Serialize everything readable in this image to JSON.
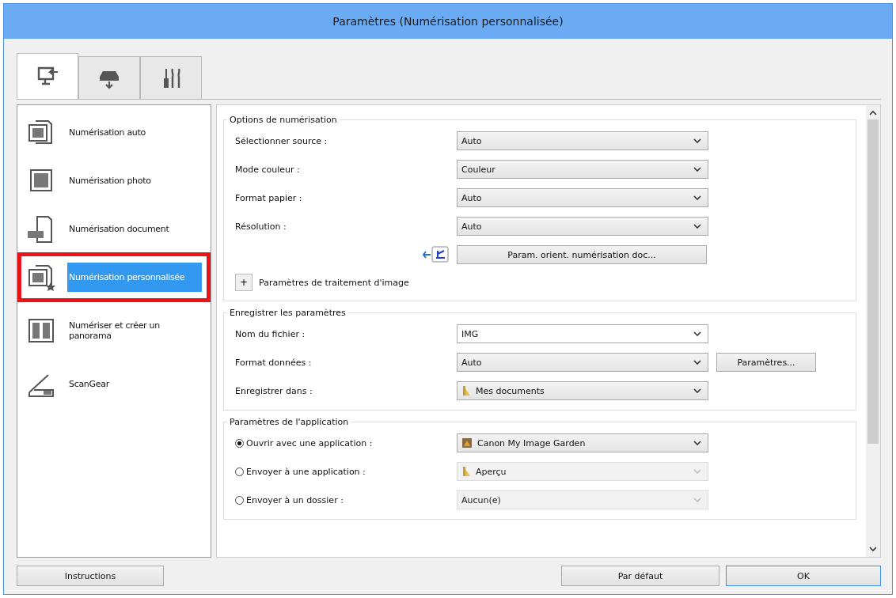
{
  "window": {
    "title": "Paramètres (Numérisation personnalisée)"
  },
  "tabs": [
    {
      "kind": "computer",
      "selected": true
    },
    {
      "kind": "scanner",
      "selected": false
    },
    {
      "kind": "tools",
      "selected": false
    }
  ],
  "sidebar": {
    "items": [
      {
        "label": "Numérisation auto",
        "kind": "auto",
        "selected": false,
        "highlighted": false
      },
      {
        "label": "Numérisation photo",
        "kind": "photo",
        "selected": false,
        "highlighted": false
      },
      {
        "label": "Numérisation document",
        "kind": "document",
        "selected": false,
        "highlighted": false
      },
      {
        "label": "Numérisation personnalisée",
        "kind": "custom",
        "selected": true,
        "highlighted": true
      },
      {
        "label": "Numériser et créer un panorama",
        "kind": "panorama",
        "selected": false,
        "highlighted": false
      },
      {
        "label": "ScanGear",
        "kind": "scangear",
        "selected": false,
        "highlighted": false
      }
    ]
  },
  "sections": [
    {
      "title": "Options de numérisation",
      "rows": [
        {
          "kind": "select",
          "label": "Sélectionner source :",
          "value": "Auto",
          "editable": false,
          "disabled": false
        },
        {
          "kind": "select",
          "label": "Mode couleur :",
          "value": "Couleur",
          "editable": false,
          "disabled": false
        },
        {
          "kind": "select",
          "label": "Format papier :",
          "value": "Auto",
          "editable": false,
          "disabled": false
        },
        {
          "kind": "select",
          "label": "Résolution :",
          "value": "Auto",
          "editable": false,
          "disabled": false
        },
        {
          "kind": "button",
          "label": "Param. orient. numérisation doc..."
        },
        {
          "kind": "expander",
          "label": "Paramètres de traitement d'image",
          "toggle": "+"
        }
      ]
    },
    {
      "title": "Enregistrer les paramètres",
      "rows": [
        {
          "kind": "select",
          "label": "Nom du fichier :",
          "value": "IMG",
          "editable": true,
          "disabled": false
        },
        {
          "kind": "select",
          "label": "Format données :",
          "value": "Auto",
          "editable": false,
          "disabled": false,
          "button": "Paramètres..."
        },
        {
          "kind": "select",
          "label": "Enregistrer dans :",
          "value": "Mes documents",
          "editable": false,
          "disabled": false
        }
      ]
    },
    {
      "title": "Paramètres de l'application",
      "rows": [
        {
          "kind": "radio",
          "label": "Ouvrir avec une application :",
          "selected": true,
          "value": "Canon My Image Garden",
          "disabled": false
        },
        {
          "kind": "radio",
          "label": "Envoyer à une application :",
          "selected": false,
          "value": "Aperçu",
          "disabled": true
        },
        {
          "kind": "radio",
          "label": "Envoyer à un dossier :",
          "selected": false,
          "value": "Aucun(e)",
          "disabled": true
        }
      ]
    }
  ],
  "buttons": [
    {
      "label": "Instructions",
      "default": false
    },
    {
      "label": "Par défaut",
      "default": false
    },
    {
      "label": "OK",
      "default": true
    }
  ]
}
